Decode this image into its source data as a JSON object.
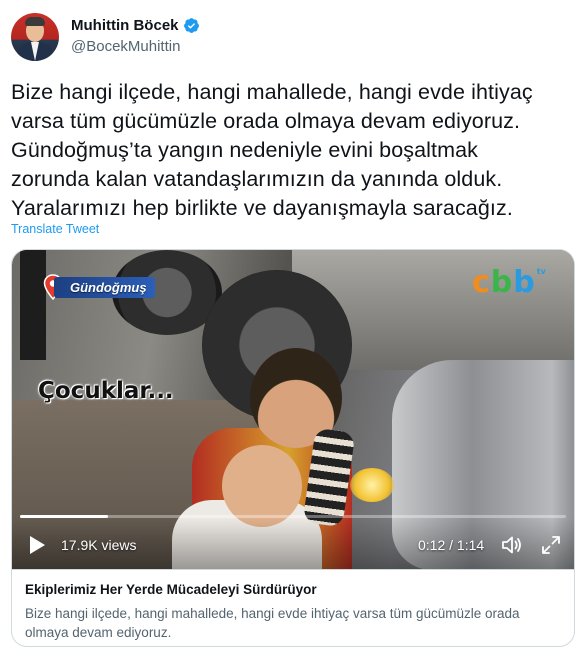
{
  "author": {
    "name": "Muhittin Böcek",
    "handle": "@BocekMuhittin",
    "verified": true
  },
  "tweet": {
    "text_lines": [
      "Bize hangi ilçede, hangi mahallede, hangi evde ihtiyaç",
      "varsa tüm gücümüzle orada olmaya devam ediyoruz.",
      "Gündoğmuş’ta yangın nedeniyle evini boşaltmak",
      "zorunda kalan vatandaşlarımızın da yanında olduk.",
      "Yaralarımızı hep birlikte ve dayanışmayla saracağız."
    ],
    "translate_label": "Translate Tweet"
  },
  "video": {
    "location_label": "Gündoğmuş",
    "caption_overlay": "Çocuklar...",
    "views": "17.9K views",
    "time": "0:12 / 1:14",
    "progress_fraction": 0.162,
    "icons": [
      "play-icon",
      "volume-icon",
      "fullscreen-icon",
      "location-pin-icon",
      "abb-tv-logo"
    ]
  },
  "card": {
    "title": "Ekiplerimiz Her Yerde Mücadeleyi Sürdürüyor",
    "description": "Bize hangi ilçede, hangi mahallede, hangi evde ihtiyaç varsa tüm gücümüzle orada olmaya devam ediyoruz."
  },
  "colors": {
    "link_blue": "#1d9bf0",
    "verified_blue": "#1d9bf0",
    "secondary_text": "#536471",
    "primary_text": "#0f1419",
    "border": "#cfd9de"
  }
}
